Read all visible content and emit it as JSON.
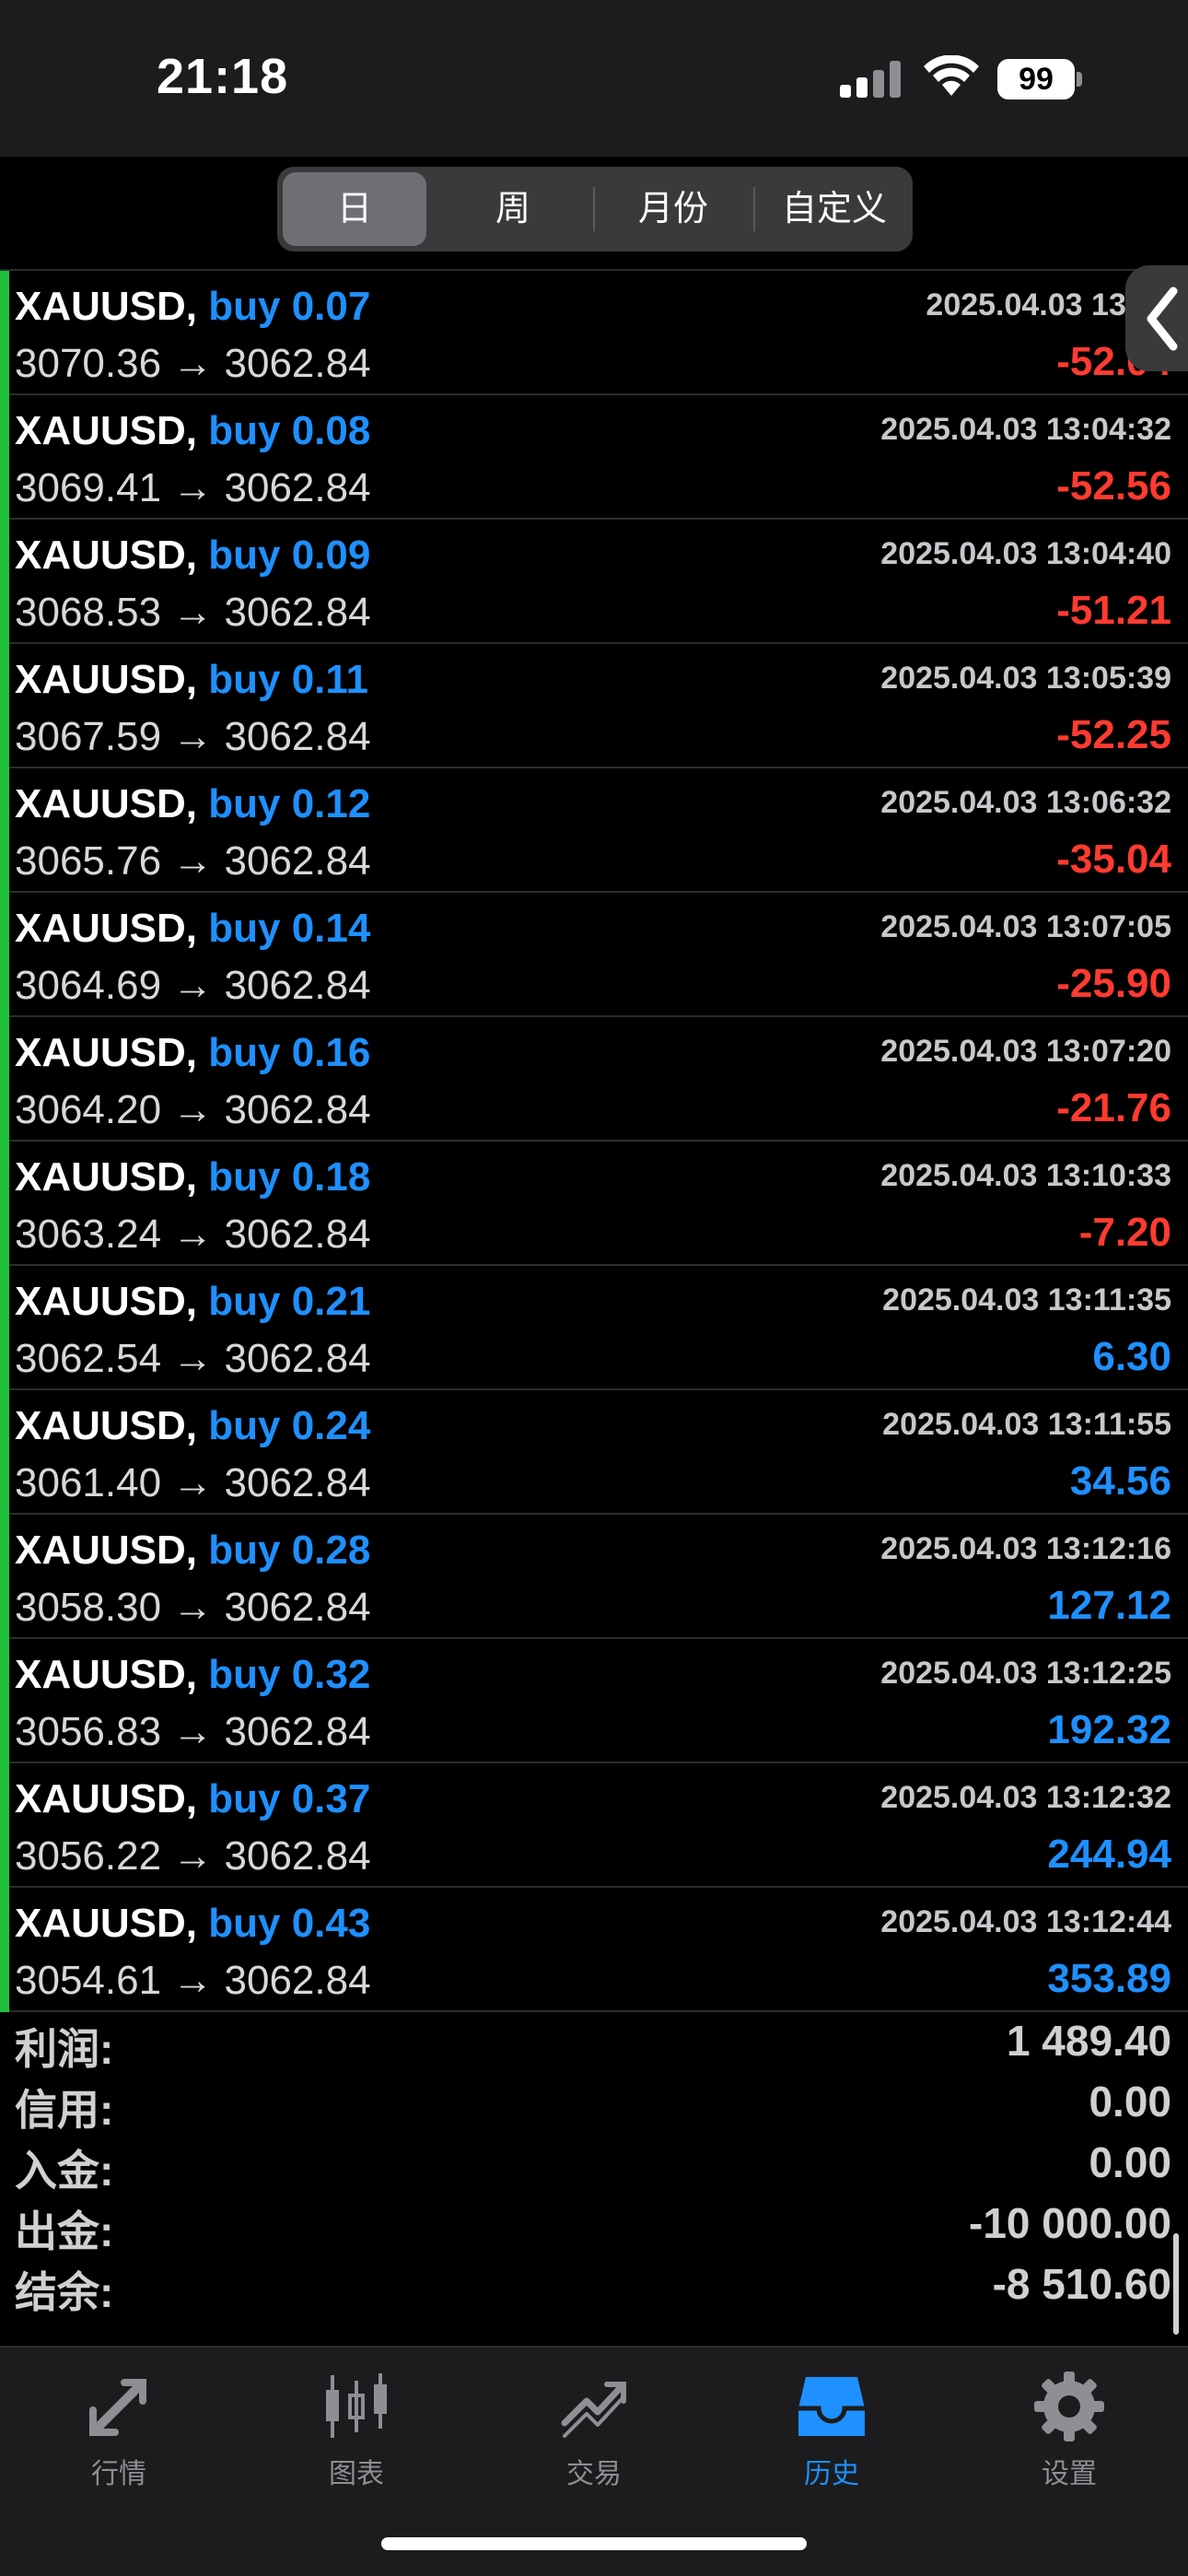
{
  "status_bar": {
    "time": "21:18",
    "battery": "99"
  },
  "period_tabs": [
    {
      "label": "日",
      "active": true
    },
    {
      "label": "周",
      "active": false
    },
    {
      "label": "月份",
      "active": false
    },
    {
      "label": "自定义",
      "active": false
    }
  ],
  "trades": [
    {
      "symbol": "XAUUSD,",
      "side": "buy 0.07",
      "prices": "3070.36 → 3062.84",
      "time": "2025.04.03 13:03",
      "pnl": "-52.04",
      "positive": false
    },
    {
      "symbol": "XAUUSD,",
      "side": "buy 0.08",
      "prices": "3069.41 → 3062.84",
      "time": "2025.04.03 13:04:32",
      "pnl": "-52.56",
      "positive": false
    },
    {
      "symbol": "XAUUSD,",
      "side": "buy 0.09",
      "prices": "3068.53 → 3062.84",
      "time": "2025.04.03 13:04:40",
      "pnl": "-51.21",
      "positive": false
    },
    {
      "symbol": "XAUUSD,",
      "side": "buy 0.11",
      "prices": "3067.59 → 3062.84",
      "time": "2025.04.03 13:05:39",
      "pnl": "-52.25",
      "positive": false
    },
    {
      "symbol": "XAUUSD,",
      "side": "buy 0.12",
      "prices": "3065.76 → 3062.84",
      "time": "2025.04.03 13:06:32",
      "pnl": "-35.04",
      "positive": false
    },
    {
      "symbol": "XAUUSD,",
      "side": "buy 0.14",
      "prices": "3064.69 → 3062.84",
      "time": "2025.04.03 13:07:05",
      "pnl": "-25.90",
      "positive": false
    },
    {
      "symbol": "XAUUSD,",
      "side": "buy 0.16",
      "prices": "3064.20 → 3062.84",
      "time": "2025.04.03 13:07:20",
      "pnl": "-21.76",
      "positive": false
    },
    {
      "symbol": "XAUUSD,",
      "side": "buy 0.18",
      "prices": "3063.24 → 3062.84",
      "time": "2025.04.03 13:10:33",
      "pnl": "-7.20",
      "positive": false
    },
    {
      "symbol": "XAUUSD,",
      "side": "buy 0.21",
      "prices": "3062.54 → 3062.84",
      "time": "2025.04.03 13:11:35",
      "pnl": "6.30",
      "positive": true
    },
    {
      "symbol": "XAUUSD,",
      "side": "buy 0.24",
      "prices": "3061.40 → 3062.84",
      "time": "2025.04.03 13:11:55",
      "pnl": "34.56",
      "positive": true
    },
    {
      "symbol": "XAUUSD,",
      "side": "buy 0.28",
      "prices": "3058.30 → 3062.84",
      "time": "2025.04.03 13:12:16",
      "pnl": "127.12",
      "positive": true
    },
    {
      "symbol": "XAUUSD,",
      "side": "buy 0.32",
      "prices": "3056.83 → 3062.84",
      "time": "2025.04.03 13:12:25",
      "pnl": "192.32",
      "positive": true
    },
    {
      "symbol": "XAUUSD,",
      "side": "buy 0.37",
      "prices": "3056.22 → 3062.84",
      "time": "2025.04.03 13:12:32",
      "pnl": "244.94",
      "positive": true
    },
    {
      "symbol": "XAUUSD,",
      "side": "buy 0.43",
      "prices": "3054.61 → 3062.84",
      "time": "2025.04.03 13:12:44",
      "pnl": "353.89",
      "positive": true
    }
  ],
  "summary": [
    {
      "label": "利润:",
      "value": "1 489.40"
    },
    {
      "label": "信用:",
      "value": "0.00"
    },
    {
      "label": "入金:",
      "value": "0.00"
    },
    {
      "label": "出金:",
      "value": "-10 000.00"
    },
    {
      "label": "结余:",
      "value": "-8 510.60"
    }
  ],
  "tabbar": [
    {
      "label": "行情",
      "icon": "quotes-icon",
      "active": false
    },
    {
      "label": "图表",
      "icon": "chart-icon",
      "active": false
    },
    {
      "label": "交易",
      "icon": "trade-icon",
      "active": false
    },
    {
      "label": "历史",
      "icon": "history-icon",
      "active": true
    },
    {
      "label": "设置",
      "icon": "settings-icon",
      "active": false
    }
  ],
  "colors": {
    "positive": "#1e90ff",
    "negative": "#ff3b30",
    "bar": "#1fbf3a",
    "accent": "#1e90ff"
  }
}
